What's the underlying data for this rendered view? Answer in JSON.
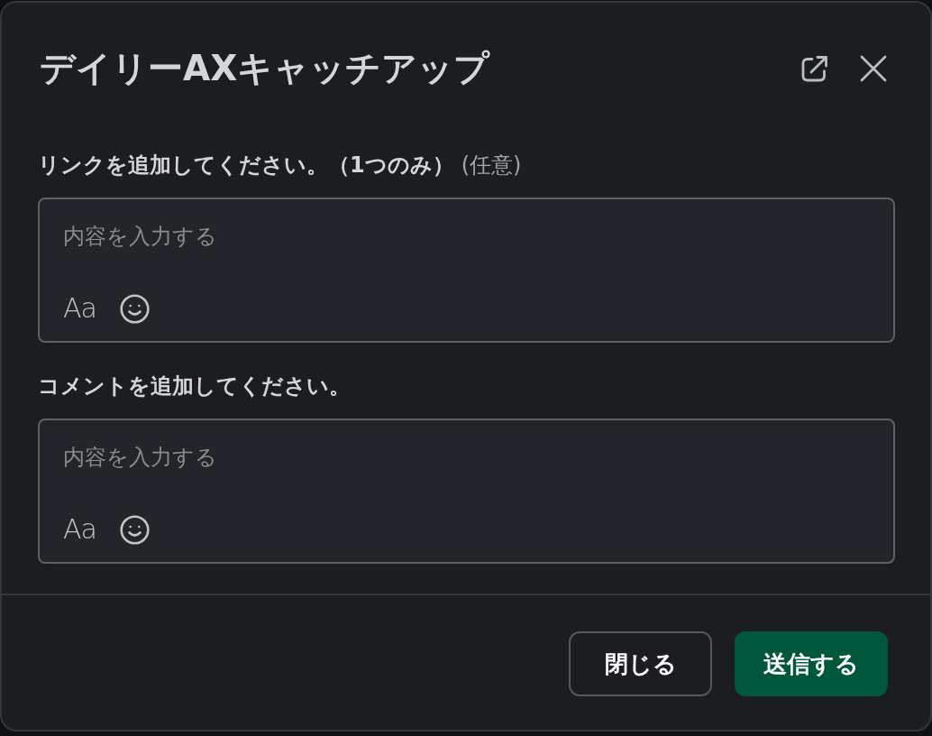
{
  "dialog": {
    "title": "デイリーAXキャッチアップ"
  },
  "fields": [
    {
      "label": "リンクを追加してください。（1つのみ）",
      "optional_note": "(任意)",
      "placeholder": "内容を入力する",
      "format_button": "Aa"
    },
    {
      "label": "コメントを追加してください。",
      "placeholder": "内容を入力する",
      "format_button": "Aa"
    }
  ],
  "buttons": [
    {
      "label": "閉じる",
      "kind": "secondary"
    },
    {
      "label": "送信する",
      "kind": "primary"
    }
  ]
}
